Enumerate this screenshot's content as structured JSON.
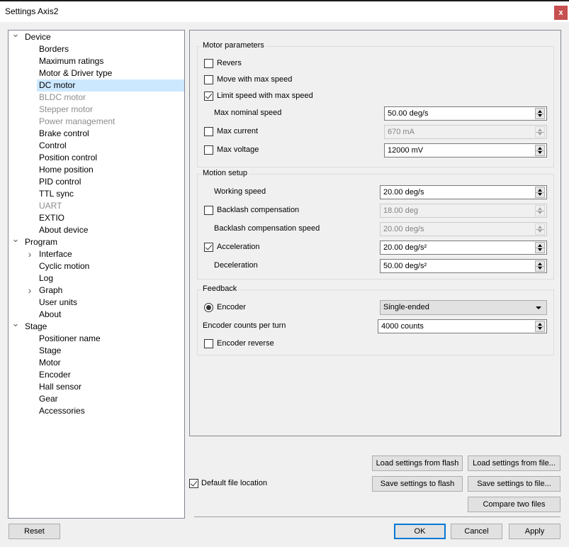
{
  "window": {
    "title": "Settings Axis2",
    "close_label": "x",
    "close_color": "#c75050"
  },
  "tree": {
    "selection_color": "#cce8ff",
    "items": [
      {
        "label": "Device",
        "level": 0,
        "expander": "expanded"
      },
      {
        "label": "Borders",
        "level": 1
      },
      {
        "label": "Maximum ratings",
        "level": 1
      },
      {
        "label": "Motor & Driver type",
        "level": 1
      },
      {
        "label": "DC motor",
        "level": 1,
        "selected": true
      },
      {
        "label": "BLDC motor",
        "level": 1,
        "disabled": true
      },
      {
        "label": "Stepper motor",
        "level": 1,
        "disabled": true
      },
      {
        "label": "Power management",
        "level": 1,
        "disabled": true
      },
      {
        "label": "Brake control",
        "level": 1
      },
      {
        "label": "Control",
        "level": 1
      },
      {
        "label": "Position control",
        "level": 1
      },
      {
        "label": "Home position",
        "level": 1
      },
      {
        "label": "PID control",
        "level": 1
      },
      {
        "label": "TTL sync",
        "level": 1
      },
      {
        "label": "UART",
        "level": 1,
        "disabled": true
      },
      {
        "label": "EXTIO",
        "level": 1
      },
      {
        "label": "About device",
        "level": 1
      },
      {
        "label": "Program",
        "level": 0,
        "expander": "expanded"
      },
      {
        "label": "Interface",
        "level": 1,
        "expander": "collapsed"
      },
      {
        "label": "Cyclic motion",
        "level": 1
      },
      {
        "label": "Log",
        "level": 1
      },
      {
        "label": "Graph",
        "level": 1,
        "expander": "collapsed"
      },
      {
        "label": "User units",
        "level": 1
      },
      {
        "label": "About",
        "level": 1
      },
      {
        "label": "Stage",
        "level": 0,
        "expander": "expanded"
      },
      {
        "label": "Positioner name",
        "level": 1
      },
      {
        "label": "Stage",
        "level": 1
      },
      {
        "label": "Motor",
        "level": 1
      },
      {
        "label": "Encoder",
        "level": 1
      },
      {
        "label": "Hall sensor",
        "level": 1
      },
      {
        "label": "Gear",
        "level": 1
      },
      {
        "label": "Accessories",
        "level": 1
      }
    ]
  },
  "motor_parameters": {
    "title": "Motor parameters",
    "revers": {
      "label": "Revers",
      "checked": false
    },
    "move_max_speed": {
      "label": "Move with max speed",
      "checked": false
    },
    "limit_speed": {
      "label": "Limit speed with max speed",
      "checked": true
    },
    "max_nominal_speed": {
      "label": "Max nominal speed",
      "value": "50.00 deg/s"
    },
    "max_current": {
      "label": "Max current",
      "checked": false,
      "value": "670 mA",
      "disabled": true
    },
    "max_voltage": {
      "label": "Max voltage",
      "checked": false,
      "value": "12000 mV"
    }
  },
  "motion_setup": {
    "title": "Motion setup",
    "working_speed": {
      "label": "Working speed",
      "value": "20.00 deg/s"
    },
    "backlash": {
      "label": "Backlash compensation",
      "checked": false,
      "value": "18.00 deg",
      "disabled": true
    },
    "backlash_speed": {
      "label": "Backlash compensation speed",
      "value": "20.00 deg/s",
      "disabled": true
    },
    "acceleration": {
      "label": "Acceleration",
      "checked": true,
      "value": "20.00 deg/s²"
    },
    "deceleration": {
      "label": "Deceleration",
      "value": "50.00 deg/s²"
    }
  },
  "feedback": {
    "title": "Feedback",
    "encoder": {
      "label": "Encoder",
      "selected": true,
      "type_value": "Single-ended"
    },
    "counts_per_turn": {
      "label": "Encoder counts per turn",
      "value": "4000 counts"
    },
    "encoder_reverse": {
      "label": "Encoder reverse",
      "checked": false
    }
  },
  "file_actions": {
    "default_location": {
      "label": "Default file location",
      "checked": true
    },
    "load_flash": "Load settings from flash",
    "load_file": "Load settings from file...",
    "save_flash": "Save settings to flash",
    "save_file": "Save settings to file...",
    "compare": "Compare two files"
  },
  "footer": {
    "reset": "Reset",
    "ok": "OK",
    "cancel": "Cancel",
    "apply": "Apply",
    "focus_color": "#0078d7"
  }
}
